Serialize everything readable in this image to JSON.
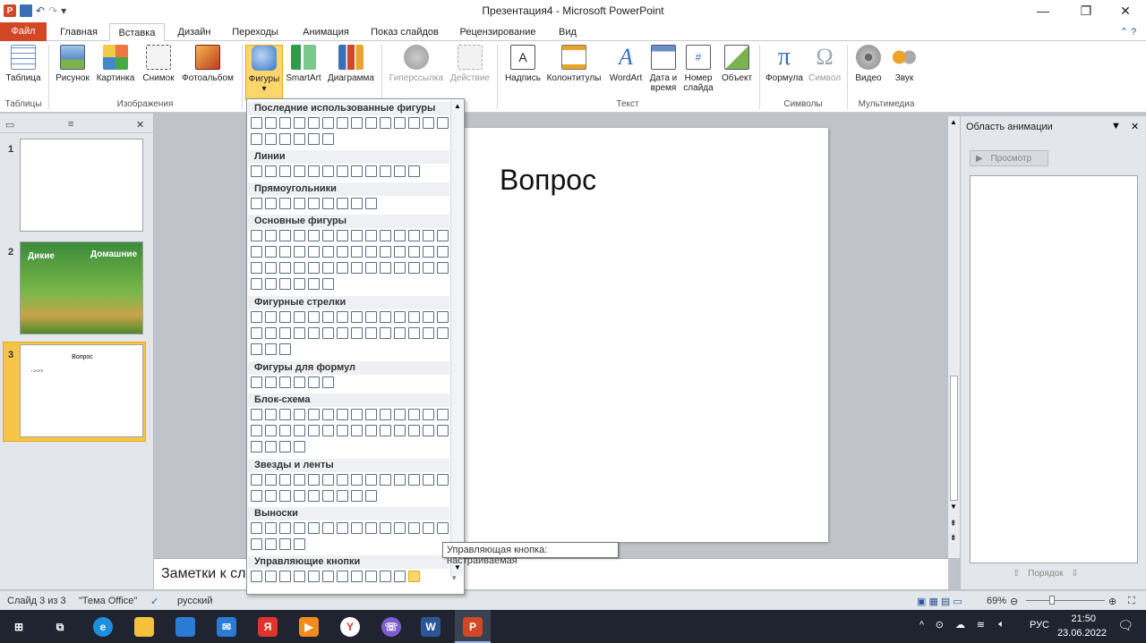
{
  "window": {
    "title": "Презентация4 - Microsoft PowerPoint"
  },
  "qat": {
    "undo_label": "↶",
    "redo_label": "↷"
  },
  "tabs": [
    {
      "label": "Файл"
    },
    {
      "label": "Главная"
    },
    {
      "label": "Вставка"
    },
    {
      "label": "Дизайн"
    },
    {
      "label": "Переходы"
    },
    {
      "label": "Анимация"
    },
    {
      "label": "Показ слайдов"
    },
    {
      "label": "Рецензирование"
    },
    {
      "label": "Вид"
    }
  ],
  "ribbon": {
    "buttons": [
      {
        "label": "Таблица"
      },
      {
        "label": "Рисунок"
      },
      {
        "label": "Картинка"
      },
      {
        "label": "Снимок"
      },
      {
        "label": "Фотоальбом"
      },
      {
        "label": "Фигуры"
      },
      {
        "label": "SmartArt"
      },
      {
        "label": "Диаграмма"
      },
      {
        "label": "Гиперссылка"
      },
      {
        "label": "Действие"
      },
      {
        "label": "Надпись"
      },
      {
        "label": "Колонтитулы"
      },
      {
        "label": "WordArt"
      },
      {
        "label": "Дата и время"
      },
      {
        "label": "Номер слайда"
      },
      {
        "label": "Объект"
      },
      {
        "label": "Формула"
      },
      {
        "label": "Символ"
      },
      {
        "label": "Видео"
      },
      {
        "label": "Звук"
      }
    ],
    "groups": [
      {
        "label": "Таблицы"
      },
      {
        "label": "Изображения"
      },
      {
        "label": "Текст"
      },
      {
        "label": "Символы"
      },
      {
        "label": "Мультимедиа"
      }
    ]
  },
  "slides": {
    "thumb2_title_left": "Дикие",
    "thumb2_title_right": "Домашние",
    "thumb3_title": "Вопрос",
    "thumb3_bullet": "• 2+2*2"
  },
  "slide": {
    "title": "Вопрос"
  },
  "notes": {
    "placeholder": "Заметки к сла"
  },
  "shapes_menu": {
    "sections": [
      {
        "label": "Последние использованные фигуры"
      },
      {
        "label": "Линии"
      },
      {
        "label": "Прямоугольники"
      },
      {
        "label": "Основные фигуры"
      },
      {
        "label": "Фигурные стрелки"
      },
      {
        "label": "Фигуры для формул"
      },
      {
        "label": "Блок-схема"
      },
      {
        "label": "Звезды и ленты"
      },
      {
        "label": "Выноски"
      },
      {
        "label": "Управляющие кнопки"
      }
    ],
    "tooltip": "Управляющая кнопка: настраиваемая"
  },
  "anim_panel": {
    "title": "Область анимации",
    "preview_label": "Просмотр",
    "order_label": "Порядок"
  },
  "status": {
    "slide_count": "Слайд 3 из 3",
    "theme": "\"Тема Office\"",
    "language": "русский",
    "zoom": "69%"
  },
  "taskbar": {
    "lang": "РУС",
    "time": "21:50",
    "date": "23.06.2022"
  },
  "colors": {
    "accent": "#d24726",
    "ribbon_selected": "#fbd66b",
    "slide_selected": "#f6c447"
  }
}
